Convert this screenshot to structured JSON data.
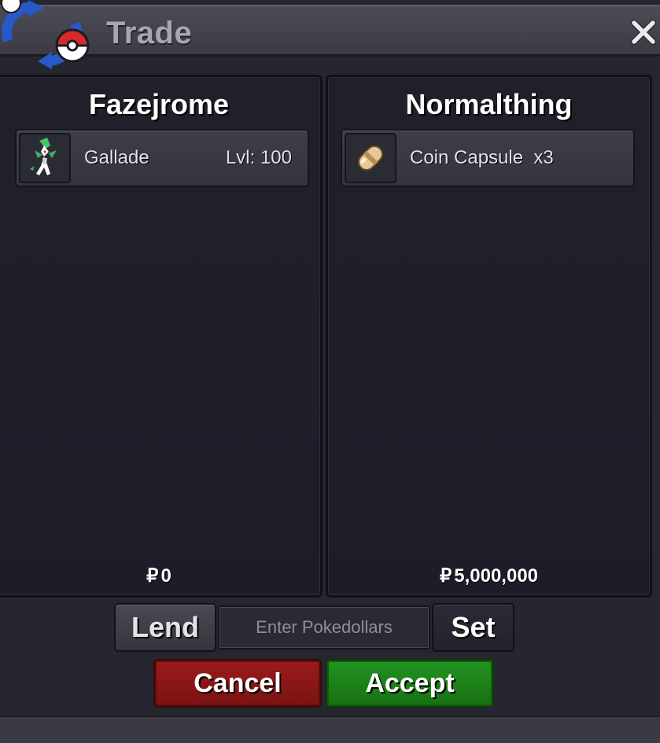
{
  "window": {
    "title": "Trade",
    "logo_icon": "trade-pokeball-arrows-icon",
    "close_icon": "close-icon"
  },
  "left_player": {
    "name": "Fazejrome",
    "items": [
      {
        "icon": "gallade-sprite-icon",
        "name": "Gallade",
        "detail": "Lvl: 100"
      }
    ],
    "money_symbol": "₽",
    "money": "0"
  },
  "right_player": {
    "name": "Normalthing",
    "items": [
      {
        "icon": "coin-capsule-icon",
        "name": "Coin Capsule  x3",
        "detail": ""
      }
    ],
    "money_symbol": "₽",
    "money": "5,000,000"
  },
  "controls": {
    "lend_label": "Lend",
    "pokedollars_placeholder": "Enter Pokedollars",
    "pokedollars_value": "",
    "set_label": "Set",
    "cancel_label": "Cancel",
    "accept_label": "Accept"
  },
  "colors": {
    "cancel": "#8b1717",
    "accept": "#1f8a1b",
    "panel": "#1f1f2a",
    "titlebar": "#44434e"
  }
}
